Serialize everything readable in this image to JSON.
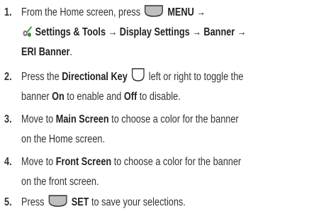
{
  "steps": [
    {
      "number": "1.",
      "t1": "From the Home screen, press",
      "b1": "MENU →",
      "b2": "Settings & Tools → Display Settings → Banner →",
      "b3": "ERI Banner",
      "t2": "."
    },
    {
      "number": "2.",
      "t1": "Press the",
      "b1": "Directional Key",
      "t2": "left or right to toggle the",
      "t3": "banner",
      "b2": "On",
      "t4": "to enable and",
      "b3": "Off",
      "t5": "to disable."
    },
    {
      "number": "3.",
      "t1": "Move to",
      "b1": "Main Screen",
      "t2": "to choose a color for the banner",
      "t3": "on the Home screen."
    },
    {
      "number": "4.",
      "t1": "Move to",
      "b1": "Front Screen",
      "t2": "to choose a color for the banner",
      "t3": "on the front screen."
    },
    {
      "number": "5.",
      "t1": "Press",
      "b1": "SET",
      "t2": "to save your selections."
    }
  ],
  "icons": {
    "menu_key": "soft-key-icon",
    "settings": "settings-tools-icon",
    "directional": "directional-key-icon",
    "set_key": "soft-key-icon"
  },
  "colors": {
    "text": "#333333",
    "icon_fill": "#bfbfbf",
    "icon_stroke": "#333333",
    "settings_green": "#3a8f3a"
  }
}
